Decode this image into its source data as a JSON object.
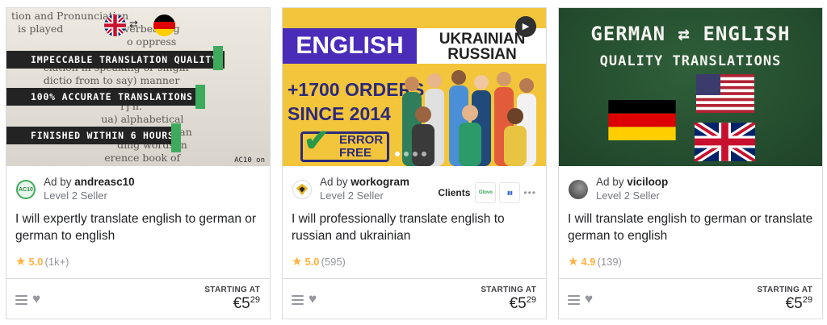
{
  "colors": {
    "star": "#ffb33e",
    "seller_name": "#222325",
    "muted": "#74767e",
    "border": "#dadbdd"
  },
  "cards": [
    {
      "thumbnail": {
        "banner_lines": [
          "IMPECCABLE TRANSLATION QUALITY",
          "100% ACCURATE TRANSLATIONS",
          "FINISHED WITHIN 6 HOURS"
        ],
        "watermark": "AC10 on",
        "icons": [
          "uk-flag-icon",
          "swap-arrows-icon",
          "germany-flag-icon"
        ]
      },
      "ad_prefix": "Ad by",
      "seller_name": "andreasc10",
      "seller_level": "Level 2 Seller",
      "avatar_text": "AC10",
      "title": "I will expertly translate english to german or german to english",
      "rating": "5.0",
      "rating_count": "(1k+)",
      "starting_at": "STARTING AT",
      "price": "€5",
      "price_cents": "29"
    },
    {
      "thumbnail": {
        "english": "ENGLISH",
        "ukrainian": "UKRAINIAN",
        "russian": "RUSSIAN",
        "orders": "+1700 ORDERS",
        "since": "SINCE 2014",
        "error_line1": "ERROR",
        "error_line2": "FREE",
        "icons": [
          "play-icon",
          "checkmark-icon"
        ]
      },
      "ad_prefix": "Ad by",
      "seller_name": "workogram",
      "seller_level": "Level 2 Seller",
      "clients_label": "Clients",
      "client_logos": [
        "Glovo",
        "client-logo-2"
      ],
      "title": "I will professionally translate english to russian and ukrainian",
      "rating": "5.0",
      "rating_count": "(595)",
      "starting_at": "STARTING AT",
      "price": "€5",
      "price_cents": "29"
    },
    {
      "thumbnail": {
        "headline_left": "GERMAN",
        "headline_right": "ENGLISH",
        "subline": "QUALITY TRANSLATIONS",
        "icons": [
          "swap-arrows-icon",
          "usa-flag-icon",
          "germany-flag-icon",
          "uk-flag-icon"
        ]
      },
      "ad_prefix": "Ad by",
      "seller_name": "viciloop",
      "seller_level": "Level 2 Seller",
      "title": "I will translate english to german or translate german to english",
      "rating": "4.9",
      "rating_count": "(139)",
      "starting_at": "STARTING AT",
      "price": "€5",
      "price_cents": "29"
    }
  ]
}
